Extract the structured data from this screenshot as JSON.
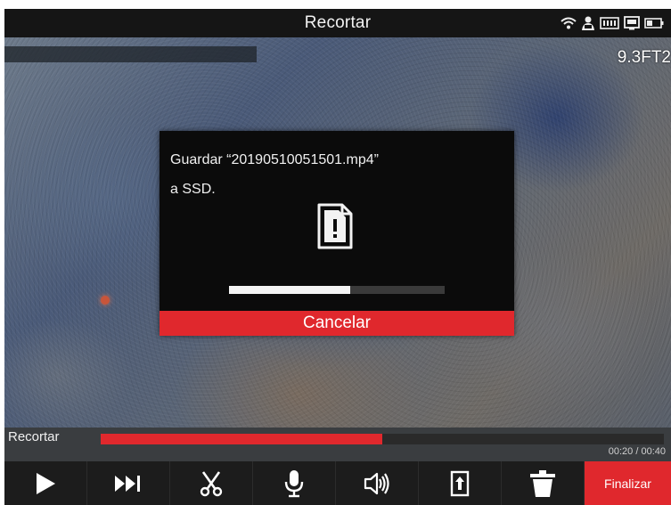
{
  "header": {
    "title": "Recortar",
    "status_icons": [
      "wifi-icon",
      "user-badge-icon",
      "battery-keyboard-icon",
      "storage-icon",
      "battery-icon"
    ]
  },
  "video": {
    "depth_readout": "9.3FT2"
  },
  "dialog": {
    "line1": "Guardar “20190510051501.mp4”",
    "line2": "a SSD.",
    "icon": "file-warning-icon",
    "progress": 0.56,
    "cancel_label": "Cancelar"
  },
  "trim": {
    "label": "Recortar",
    "timecode": "00:20 / 00:40",
    "progress": 0.5
  },
  "toolbar": {
    "items": [
      "play-icon",
      "skip-next-icon",
      "scissors-icon",
      "microphone-icon",
      "speaker-icon",
      "export-icon",
      "trash-icon"
    ],
    "finalize_label": "Finalizar"
  },
  "colors": {
    "accent": "#e0282d",
    "titlebar": "#151515",
    "toolbar": "#1c1c1c"
  }
}
